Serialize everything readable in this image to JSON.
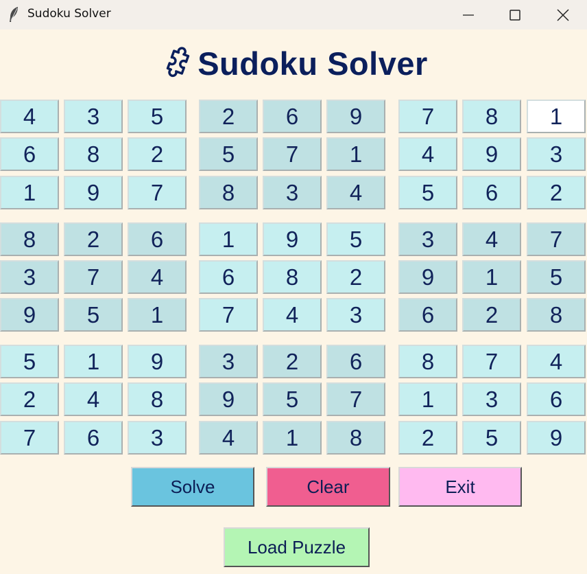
{
  "window": {
    "title": "Sudoku Solver"
  },
  "header": {
    "title": "Sudoku Solver",
    "icon": "puzzle-piece-icon"
  },
  "grid": [
    [
      "4",
      "3",
      "5",
      "2",
      "6",
      "9",
      "7",
      "8",
      "1"
    ],
    [
      "6",
      "8",
      "2",
      "5",
      "7",
      "1",
      "4",
      "9",
      "3"
    ],
    [
      "1",
      "9",
      "7",
      "8",
      "3",
      "4",
      "5",
      "6",
      "2"
    ],
    [
      "8",
      "2",
      "6",
      "1",
      "9",
      "5",
      "3",
      "4",
      "7"
    ],
    [
      "3",
      "7",
      "4",
      "6",
      "8",
      "2",
      "9",
      "1",
      "5"
    ],
    [
      "9",
      "5",
      "1",
      "7",
      "4",
      "3",
      "6",
      "2",
      "8"
    ],
    [
      "5",
      "1",
      "9",
      "3",
      "2",
      "6",
      "8",
      "7",
      "4"
    ],
    [
      "2",
      "4",
      "8",
      "9",
      "5",
      "7",
      "1",
      "3",
      "6"
    ],
    [
      "7",
      "6",
      "3",
      "4",
      "1",
      "8",
      "2",
      "5",
      "9"
    ]
  ],
  "colors": {
    "cell_light": "#c6eff0",
    "cell_dark": "#bfe1e3",
    "cell_focused": "#ffffff",
    "background": "#fdf5e6",
    "title_text": "#0b1f5c"
  },
  "buttons": {
    "solve": {
      "label": "Solve",
      "color": "#6ac4df"
    },
    "clear": {
      "label": "Clear",
      "color": "#f05e90"
    },
    "exit": {
      "label": "Exit",
      "color": "#ffbaf0"
    },
    "load": {
      "label": "Load Puzzle",
      "color": "#b4f5b4"
    }
  }
}
